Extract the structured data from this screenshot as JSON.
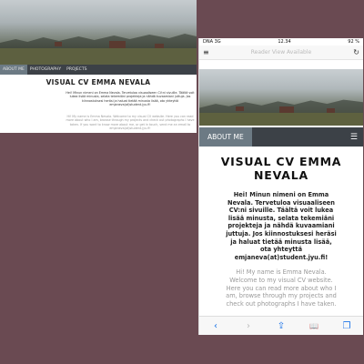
{
  "desktop": {
    "nav": [
      "ABOUT ME",
      "PHOTOGRAPHY",
      "PROJECTS"
    ],
    "title": "VISUAL CV EMMA NEVALA",
    "para_fi": "Hei! Minun nimeni on Emma Nevala. Tervetuloa visuaaliseen CV:ni sivuille. Täältä voit lukea lisää minusta, selata tekemiäni projekteja ja nähdä kuvaamiani juttuja. Jos kiinnostuksesi heräsi ja haluat tietää minusta lisää, ota yhteyttä emjaneva(at)student.jyu.fi!",
    "para_en": "Hi! My name is Emma Nevala. Welcome to my visual CV website. Here you can read more about who I am, browse through my projects and check out photographs I have taken. If you want to know more about me, or get in touch, send me an email to emjaneva(at)student.jyu.fi!"
  },
  "phone": {
    "status": {
      "carrier": "DNA 3G",
      "time": "12.34",
      "battery": "92 %"
    },
    "url_text": "Reader View Available",
    "nav_active": "ABOUT ME",
    "title": "VISUAL CV EMMA NEVALA",
    "para_fi": "Hei! Minun nimeni on Emma Nevala. Tervetuloa visuaaliseen CV:ni sivuille. Täältä voit lukea lisää minusta, selata tekemiäni projekteja ja nähdä kuvaamiani juttuja. Jos kiinnostuksesi heräsi ja haluat tietää minusta lisää, ota yhteyttä emjaneva(at)student.jyu.fi!",
    "para_en": "Hi! My name is Emma Nevala. Welcome to my visual CV website. Here you can read more about who I am, browse through my projects and check out photographs I have taken."
  },
  "icons": {
    "menu": "☰",
    "reload": "↻",
    "back": "‹",
    "forward": "›",
    "share": "⇪",
    "bookmarks": "📖",
    "tabs": "❐",
    "hamburger": "≡"
  },
  "colors": {
    "background": "#6a4a52",
    "nav": "#3c4147",
    "nav_active": "#6c7a84",
    "ios_blue": "#1a73e8"
  }
}
